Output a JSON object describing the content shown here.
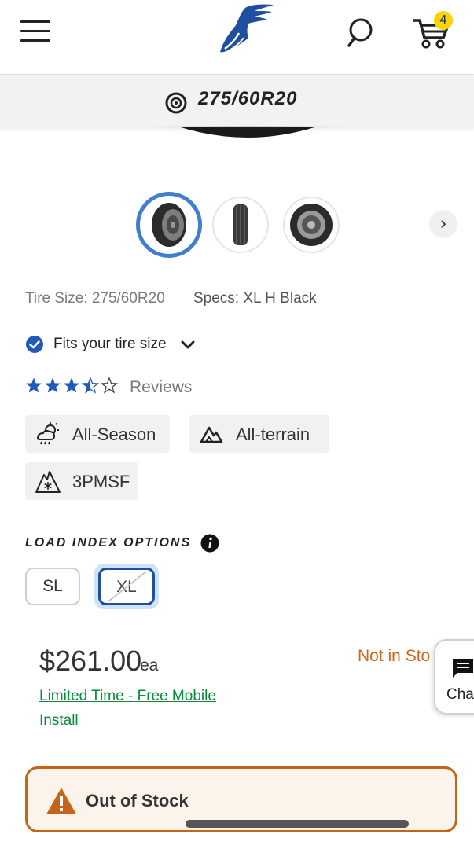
{
  "header": {
    "menu_icon": "hamburger-menu-icon",
    "logo_icon": "winged-foot-logo-icon",
    "search_icon": "search-icon",
    "cart_icon": "shopping-cart-icon",
    "cart_count": "4"
  },
  "size_bar": {
    "icon": "tire-icon",
    "size": "275/60R20"
  },
  "gallery": {
    "thumbnails": [
      "tire-angle-view",
      "tire-tread-view",
      "tire-wheel-view"
    ],
    "active_index": 0,
    "next_label": "›"
  },
  "specs": {
    "tire_size": "Tire Size: 275/60R20",
    "specs": "Specs: XL H Black"
  },
  "fitment": {
    "label": "Fits your tire size",
    "check_icon": "check-circle-icon",
    "chevron_icon": "chevron-down-icon"
  },
  "rating": {
    "stars": 3.5,
    "max_stars": 5,
    "reviews_label": "Reviews"
  },
  "features": [
    {
      "icon": "weather-all-season-icon",
      "label": "All-Season"
    },
    {
      "icon": "mountain-terrain-icon",
      "label": "All-terrain"
    },
    {
      "icon": "snowflake-mountain-icon",
      "label": "3PMSF"
    }
  ],
  "load_index": {
    "title": "LOAD INDEX OPTIONS",
    "info_icon": "info-icon",
    "options": [
      {
        "label": "SL",
        "selected": false
      },
      {
        "label": "XL",
        "selected": true
      }
    ]
  },
  "pricing": {
    "price": "$261.00",
    "unit": "ea",
    "promo": "Limited Time - Free Mobile Install",
    "stock_status": "Not in Sto"
  },
  "chat": {
    "icon": "chat-bubble-icon",
    "label": "Chat"
  },
  "alert": {
    "icon": "warning-triangle-icon",
    "text": "Out of Stock"
  },
  "colors": {
    "brand_blue": "#1f4fa0",
    "star_blue": "#1f5bb8",
    "accent_orange": "#c46419",
    "promo_green": "#0a8a3a",
    "badge_yellow": "#f6d500"
  }
}
